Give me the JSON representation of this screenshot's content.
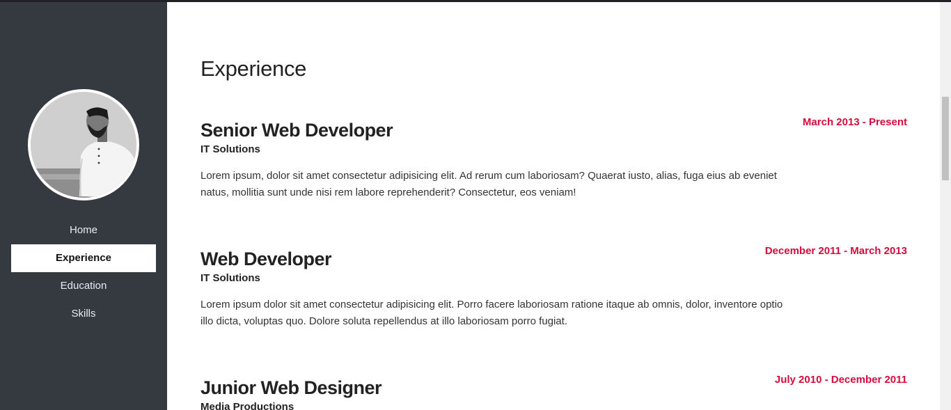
{
  "sidebar": {
    "nav": [
      {
        "label": "Home",
        "active": false
      },
      {
        "label": "Experience",
        "active": true
      },
      {
        "label": "Education",
        "active": false
      },
      {
        "label": "Skills",
        "active": false
      }
    ]
  },
  "main": {
    "section_title": "Experience",
    "entries": [
      {
        "title": "Senior Web Developer",
        "company": "IT Solutions",
        "description": "Lorem ipsum, dolor sit amet consectetur adipisicing elit. Ad rerum cum laboriosam? Quaerat iusto, alias, fuga eius ab eveniet natus, mollitia sunt unde nisi rem labore reprehenderit? Consectetur, eos veniam!",
        "date": "March 2013 - Present"
      },
      {
        "title": "Web Developer",
        "company": "IT Solutions",
        "description": "Lorem ipsum dolor sit amet consectetur adipisicing elit. Porro facere laboriosam ratione itaque ab omnis, dolor, inventore optio illo dicta, voluptas quo. Dolore soluta repellendus at illo laboriosam porro fugiat.",
        "date": "December 2011 - March 2013"
      },
      {
        "title": "Junior Web Designer",
        "company": "Media Productions",
        "description": "",
        "date": "July 2010 - December 2011"
      }
    ]
  },
  "colors": {
    "sidebar_bg": "#343a40",
    "accent_date": "#d40c3c",
    "active_nav_bg": "#ffffff"
  },
  "icons": {
    "avatar": "profile-photo"
  }
}
